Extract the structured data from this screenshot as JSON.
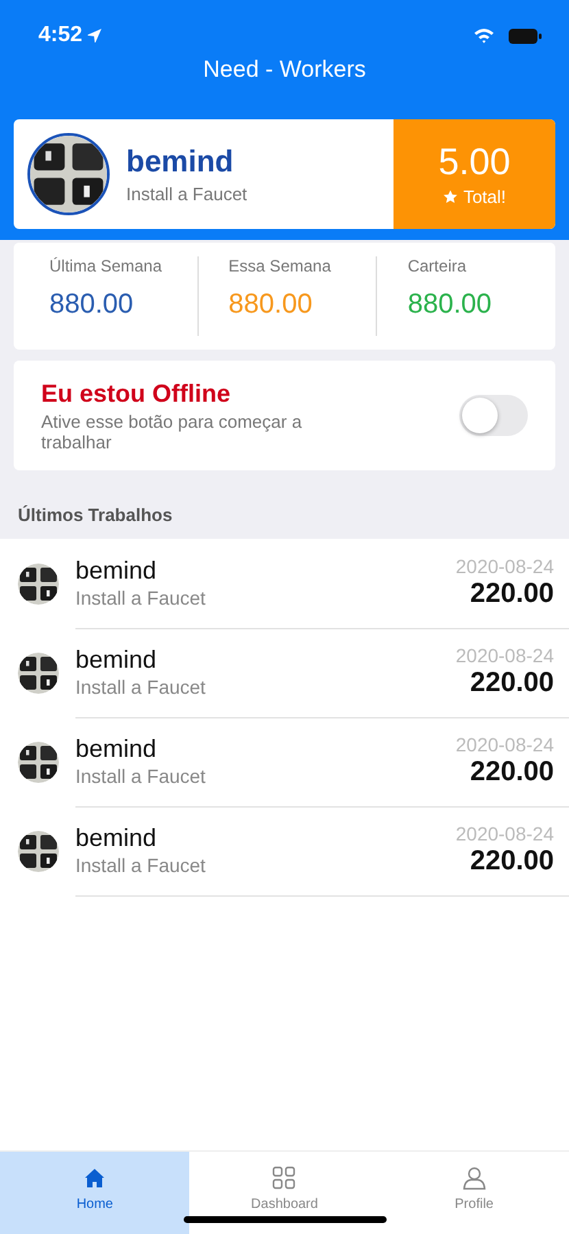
{
  "status_bar": {
    "time": "4:52"
  },
  "header": {
    "title": "Need - Workers"
  },
  "profile": {
    "name": "bemind",
    "subtitle": "Install a Faucet",
    "score": "5.00",
    "score_label": "Total!"
  },
  "stats": [
    {
      "label": "Última Semana",
      "value": "880.00",
      "color": "#2a5db0"
    },
    {
      "label": "Essa Semana",
      "value": "880.00",
      "color": "#f7981d"
    },
    {
      "label": "Carteira",
      "value": "880.00",
      "color": "#2bb24c"
    }
  ],
  "status_card": {
    "title": "Eu estou Offline",
    "description": "Ative esse botão para começar a trabalhar",
    "on": false
  },
  "section_title": "Últimos Trabalhos",
  "jobs": [
    {
      "name": "bemind",
      "subtitle": "Install a Faucet",
      "date": "2020-08-24",
      "amount": "220.00"
    },
    {
      "name": "bemind",
      "subtitle": "Install a Faucet",
      "date": "2020-08-24",
      "amount": "220.00"
    },
    {
      "name": "bemind",
      "subtitle": "Install a Faucet",
      "date": "2020-08-24",
      "amount": "220.00"
    },
    {
      "name": "bemind",
      "subtitle": "Install a Faucet",
      "date": "2020-08-24",
      "amount": "220.00"
    }
  ],
  "tabs": [
    {
      "label": "Home",
      "kind": "home",
      "selected": true
    },
    {
      "label": "Dashboard",
      "kind": "grid",
      "selected": false
    },
    {
      "label": "Profile",
      "kind": "person",
      "selected": false
    }
  ]
}
